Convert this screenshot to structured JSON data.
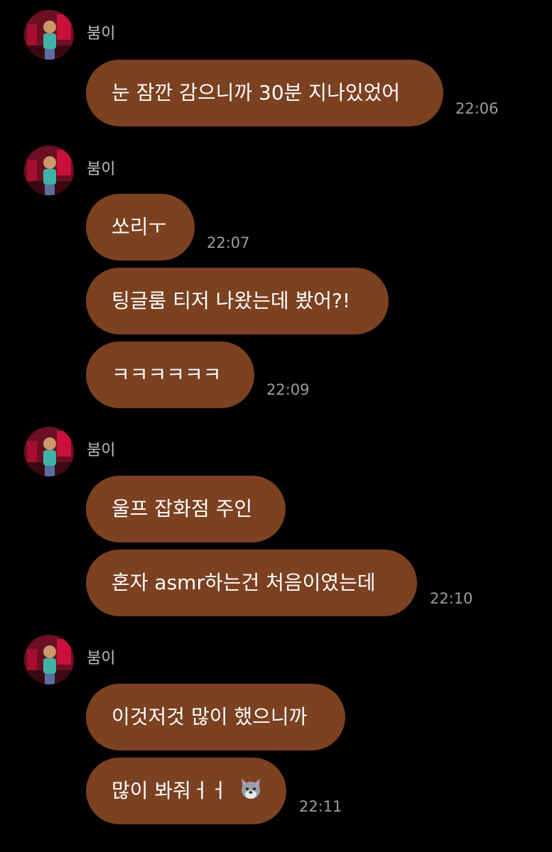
{
  "colors": {
    "background": "#000000",
    "bubble": "#7b4121",
    "bubble_text": "#ffffff",
    "sender_name": "#bdbdbd",
    "timestamp": "#9e9e9e"
  },
  "groups": [
    {
      "sender": "붐이",
      "messages": [
        {
          "text": "눈 잠깐 감으니까 30분 지나있었어",
          "time": "22:06"
        }
      ]
    },
    {
      "sender": "붐이",
      "messages": [
        {
          "text": "쏘리ㅜ",
          "time": "22:07"
        },
        {
          "text": "팅글룸 티저 나왔는데 봤어?!"
        },
        {
          "text": "ㅋㅋㅋㅋㅋㅋ",
          "time": "22:09"
        }
      ]
    },
    {
      "sender": "붐이",
      "messages": [
        {
          "text": "울프 잡화점 주인"
        },
        {
          "text": "혼자 asmr하는건 처음이였는데",
          "time": "22:10"
        }
      ]
    },
    {
      "sender": "붐이",
      "messages": [
        {
          "text": "이것저것 많이 했으니까"
        },
        {
          "text": "많이 봐줘ㅓㅓ",
          "emoji": "wolf-emoji",
          "time": "22:11"
        }
      ]
    }
  ]
}
